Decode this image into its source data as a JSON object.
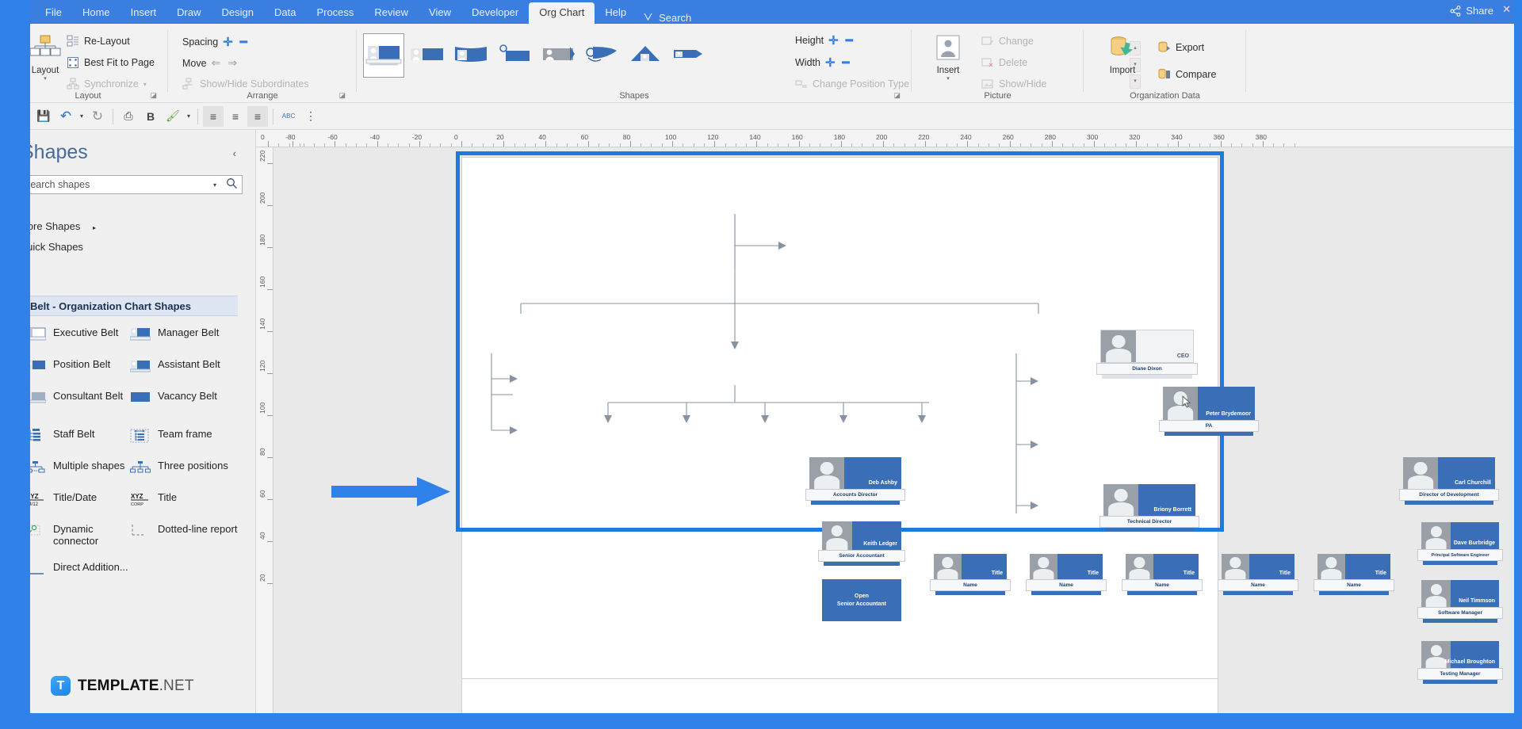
{
  "window": {
    "share_label": "Share",
    "close_label": "✕"
  },
  "tabs": [
    {
      "label": "File",
      "active": false
    },
    {
      "label": "Home",
      "active": false
    },
    {
      "label": "Insert",
      "active": false
    },
    {
      "label": "Draw",
      "active": false
    },
    {
      "label": "Design",
      "active": false
    },
    {
      "label": "Data",
      "active": false
    },
    {
      "label": "Process",
      "active": false
    },
    {
      "label": "Review",
      "active": false
    },
    {
      "label": "View",
      "active": false
    },
    {
      "label": "Developer",
      "active": false
    },
    {
      "label": "Org Chart",
      "active": true
    },
    {
      "label": "Help",
      "active": false
    }
  ],
  "search_tab": {
    "label": "Search",
    "icon": "lightbulb-icon"
  },
  "ribbon": {
    "groups": [
      {
        "name": "Layout",
        "label": "Layout"
      },
      {
        "name": "Arrange",
        "label": "Arrange"
      },
      {
        "name": "Shapes",
        "label": "Shapes"
      },
      {
        "name": "Picture",
        "label": "Picture"
      },
      {
        "name": "OrganizationData",
        "label": "Organization Data"
      }
    ],
    "layout": {
      "big_button": "Layout",
      "items": [
        {
          "label": "Re-Layout",
          "disabled": false
        },
        {
          "label": "Best Fit to Page",
          "disabled": false
        },
        {
          "label": "Synchronize",
          "disabled": true
        }
      ]
    },
    "arrange": {
      "items": [
        {
          "label": "Spacing",
          "disabled": false
        },
        {
          "label": "Move",
          "disabled": false
        },
        {
          "label": "Show/Hide Subordinates",
          "disabled": true
        }
      ]
    },
    "size": {
      "height_label": "Height",
      "width_label": "Width",
      "change_position_label": "Change Position Type"
    },
    "picture": {
      "insert_label": "Insert",
      "items": [
        {
          "label": "Change",
          "disabled": true
        },
        {
          "label": "Delete",
          "disabled": true
        },
        {
          "label": "Show/Hide",
          "disabled": true
        }
      ]
    },
    "organization_data": {
      "import_label": "Import",
      "items": [
        {
          "label": "Export",
          "disabled": false
        },
        {
          "label": "Compare",
          "disabled": false
        }
      ]
    }
  },
  "quick_toolbar": {
    "buttons": [
      {
        "name": "save-button",
        "glyph": "💾"
      },
      {
        "name": "undo-button",
        "glyph": "↶"
      },
      {
        "name": "redo-button",
        "glyph": "↻"
      },
      {
        "name": "format-painter-button",
        "glyph": "⎙"
      },
      {
        "name": "bold-button",
        "glyph": "B"
      },
      {
        "name": "fill-color-button",
        "glyph": "🖌"
      },
      {
        "name": "align-center-button",
        "glyph": "≡"
      },
      {
        "name": "align-left-button",
        "glyph": "≡"
      },
      {
        "name": "align-right-button",
        "glyph": "≡"
      },
      {
        "name": "spelling-button",
        "glyph": "ABC"
      },
      {
        "name": "more-commands-button",
        "glyph": "⋮"
      }
    ]
  },
  "shapes_panel": {
    "title": "Shapes",
    "collapse_icon": "chevron-left-icon",
    "search_placeholder": "Search shapes",
    "search_value": "",
    "more_shapes": "More Shapes",
    "quick_shapes": "Quick Shapes",
    "stencil_title": "Belt - Organization Chart Shapes",
    "items": [
      {
        "label": "Executive Belt",
        "icon": "executive-belt-icon"
      },
      {
        "label": "Manager Belt",
        "icon": "manager-belt-icon"
      },
      {
        "label": "Position Belt",
        "icon": "position-belt-icon"
      },
      {
        "label": "Assistant Belt",
        "icon": "assistant-belt-icon"
      },
      {
        "label": "Consultant Belt",
        "icon": "consultant-belt-icon"
      },
      {
        "label": "Vacancy Belt",
        "icon": "vacancy-belt-icon"
      },
      {
        "label": "Staff Belt",
        "icon": "staff-belt-icon"
      },
      {
        "label": "Team frame",
        "icon": "team-frame-icon"
      },
      {
        "label": "Multiple shapes",
        "icon": "multiple-shapes-icon"
      },
      {
        "label": "Three positions",
        "icon": "three-positions-icon"
      },
      {
        "label": "Title/Date",
        "icon": "title-date-icon"
      },
      {
        "label": "Title",
        "icon": "title-icon"
      },
      {
        "label": "Dynamic connector",
        "icon": "dynamic-connector-icon"
      },
      {
        "label": "Dotted-line report",
        "icon": "dotted-line-report-icon"
      },
      {
        "label": "Direct Addition...",
        "icon": "direct-addition-icon"
      }
    ]
  },
  "rulers": {
    "horizontal_ticks": [
      "0",
      "-80",
      "-60",
      "-40",
      "-20",
      "0",
      "20",
      "40",
      "60",
      "80",
      "100",
      "120",
      "140",
      "160",
      "180",
      "200",
      "220",
      "240",
      "260",
      "280",
      "300",
      "320",
      "340",
      "360",
      "380"
    ],
    "vertical_ticks": [
      "220",
      "200",
      "180",
      "160",
      "140",
      "120",
      "100",
      "80",
      "60",
      "40",
      "20"
    ]
  },
  "org_chart": {
    "nodes": [
      {
        "id": "ceo",
        "name": "Diane Dixon",
        "title": "CEO",
        "type": "executive"
      },
      {
        "id": "pa",
        "name": "Peter Brydemoor",
        "title": "PA",
        "type": "assistant"
      },
      {
        "id": "acct",
        "name": "Deb Ashby",
        "title": "Accounts Director",
        "type": "manager"
      },
      {
        "id": "tech",
        "name": "Briony Borrett",
        "title": "Technical Director",
        "type": "manager"
      },
      {
        "id": "dev",
        "name": "Carl Churchill",
        "title": "Director of Development",
        "type": "manager"
      },
      {
        "id": "snracct",
        "name": "Keith Ledger",
        "title": "Senior Accountant",
        "type": "position"
      },
      {
        "id": "vacacct",
        "name": "Open",
        "title": "Senior Accountant",
        "type": "vacancy"
      },
      {
        "id": "p1",
        "name": "Title",
        "title": "Name",
        "type": "position"
      },
      {
        "id": "p2",
        "name": "Title",
        "title": "Name",
        "type": "position"
      },
      {
        "id": "p3",
        "name": "Title",
        "title": "Name",
        "type": "position"
      },
      {
        "id": "p4",
        "name": "Title",
        "title": "Name",
        "type": "position"
      },
      {
        "id": "p5",
        "name": "Title",
        "title": "Name",
        "type": "position"
      },
      {
        "id": "d1",
        "name": "Dave Burbridge",
        "title": "Principal Software Engineer",
        "type": "position"
      },
      {
        "id": "d2",
        "name": "Neil Timmson",
        "title": "Software Manager",
        "type": "position"
      },
      {
        "id": "d3",
        "name": "Michael Broughton",
        "title": "Testing Manager",
        "type": "position"
      }
    ]
  },
  "watermark": {
    "brand_bold": "TEMPLATE",
    "brand_light": ".NET",
    "badge_letter": "T"
  }
}
